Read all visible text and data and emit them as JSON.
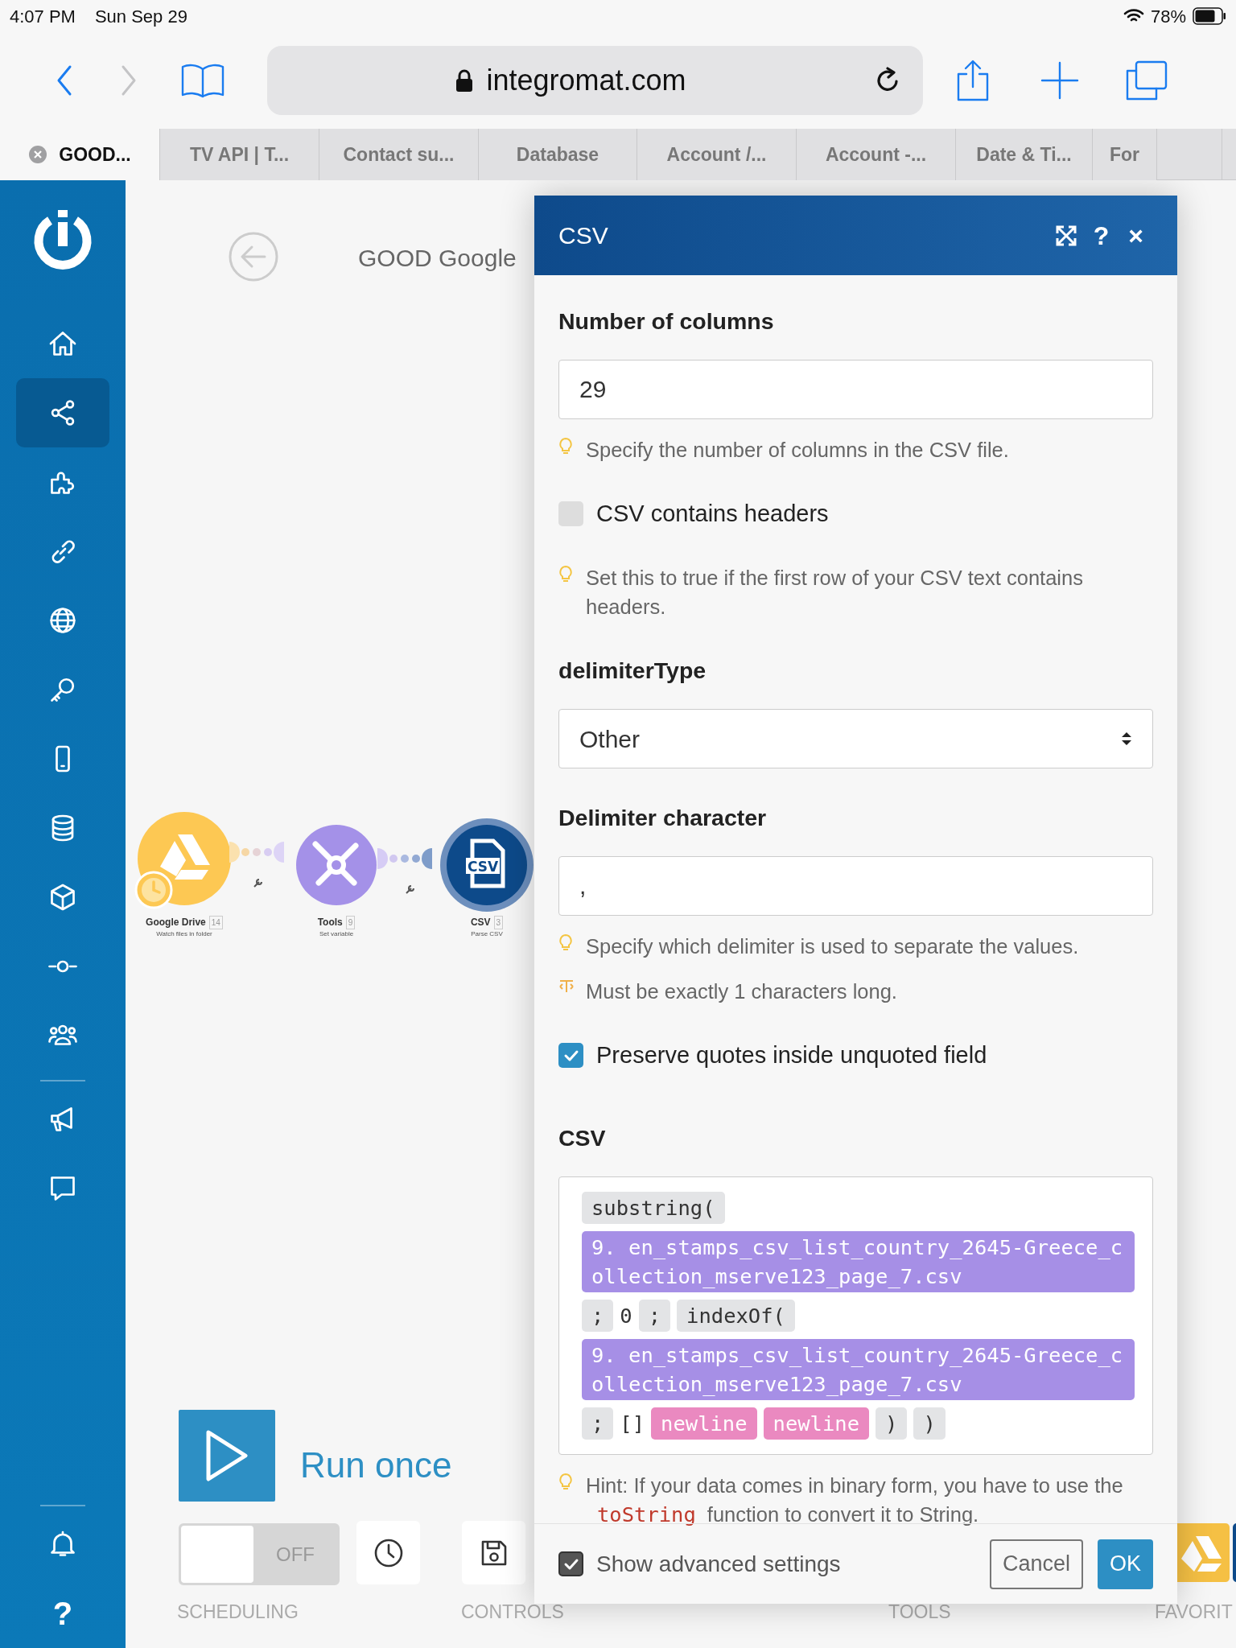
{
  "status_bar": {
    "time": "4:07 PM",
    "date": "Sun Sep 29",
    "battery": "78%"
  },
  "browser": {
    "back": {
      "disabled": false
    },
    "forward": {
      "disabled": true
    },
    "url": "integromat.com",
    "tabs": [
      {
        "label": "GOOD...",
        "selected": true
      },
      {
        "label": "TV API | T...",
        "selected": false
      },
      {
        "label": "Contact su...",
        "selected": false
      },
      {
        "label": "Database",
        "selected": false
      },
      {
        "label": "Account /...",
        "selected": false
      },
      {
        "label": "Account -...",
        "selected": false
      },
      {
        "label": "Date & Ti...",
        "selected": false
      },
      {
        "label": "For",
        "selected": false
      }
    ]
  },
  "sidebar": {
    "items": [
      {
        "selected": false
      },
      {
        "selected": true
      },
      {
        "selected": false
      },
      {
        "selected": false
      },
      {
        "selected": false
      },
      {
        "selected": false
      },
      {
        "selected": false
      },
      {
        "selected": false
      },
      {
        "selected": false
      },
      {
        "selected": false
      },
      {
        "selected": false
      }
    ],
    "extra_items": [
      {
        "selected": false
      },
      {
        "selected": false
      }
    ],
    "bottom_items": [
      {
        "selected": false
      },
      {
        "selected": false,
        "label": "?"
      }
    ]
  },
  "scenario": {
    "title": "GOOD Google",
    "nodes": [
      {
        "kind": "drive",
        "name": "Google Drive",
        "count": "14",
        "action": "Watch files in folder",
        "scheduled": true
      },
      {
        "kind": "tools",
        "name": "Tools",
        "count": "9",
        "action": "Set variable"
      },
      {
        "kind": "csv",
        "name": "CSV",
        "count": "3",
        "action": "Parse CSV",
        "icon_text": "CSV"
      }
    ],
    "run_once": "Run once",
    "scheduling": {
      "on": false,
      "label": "OFF"
    },
    "sections": [
      "SCHEDULING",
      "CONTROLS",
      "TOOLS",
      "FAVORIT"
    ]
  },
  "panel": {
    "title": "CSV",
    "actions": [
      "?",
      "×"
    ],
    "fields": [
      {
        "kind": "input",
        "label": "Number of columns",
        "value": "29",
        "hints": [
          {
            "kind": "tip",
            "text": "Specify the number of columns in the CSV file."
          }
        ]
      },
      {
        "kind": "checkbox",
        "label": "CSV contains headers",
        "checked": false,
        "hints": [
          {
            "kind": "tip",
            "text": "Set this to true if the first row of your CSV text contains headers."
          }
        ]
      },
      {
        "kind": "select",
        "label": "delimiterType",
        "value": "Other"
      },
      {
        "kind": "input",
        "label": "Delimiter character",
        "value": ",",
        "hints": [
          {
            "kind": "tip",
            "text": "Specify which delimiter is used to separate the values."
          },
          {
            "kind": "length",
            "text": "Must be exactly 1 characters long."
          }
        ]
      },
      {
        "kind": "checkbox",
        "label": "Preserve quotes inside unquoted field",
        "checked": true
      },
      {
        "kind": "code",
        "label": "CSV",
        "tokens": [
          {
            "kind": "function",
            "text": "substring("
          },
          {
            "kind": "variable",
            "text": "9. en_stamps_csv_list_country_2645-Greece_collection_mserve123_page_7.csv"
          },
          {
            "kind": "function",
            "text": ";"
          },
          {
            "kind": "plain",
            "text": "0"
          },
          {
            "kind": "function",
            "text": ";"
          },
          {
            "kind": "function",
            "text": "indexOf("
          },
          {
            "kind": "variable",
            "text": "9. en_stamps_csv_list_country_2645-Greece_collection_mserve123_page_7.csv"
          },
          {
            "kind": "function",
            "text": ";"
          },
          {
            "kind": "plain",
            "text": "[]"
          },
          {
            "kind": "keyword",
            "text": "newline"
          },
          {
            "kind": "keyword",
            "text": "newline"
          },
          {
            "kind": "function",
            "text": ")"
          },
          {
            "kind": "function",
            "text": ")"
          }
        ],
        "hints": [
          {
            "kind": "tip",
            "before": "Hint: If your data comes in binary form, you have to use the",
            "code": "toString",
            "after": "function to convert it to String."
          }
        ]
      }
    ],
    "advanced": {
      "label": "Show advanced settings",
      "checked": true
    },
    "buttons": [
      {
        "kind": "secondary",
        "label": "Cancel"
      },
      {
        "kind": "primary",
        "label": "OK"
      }
    ]
  }
}
